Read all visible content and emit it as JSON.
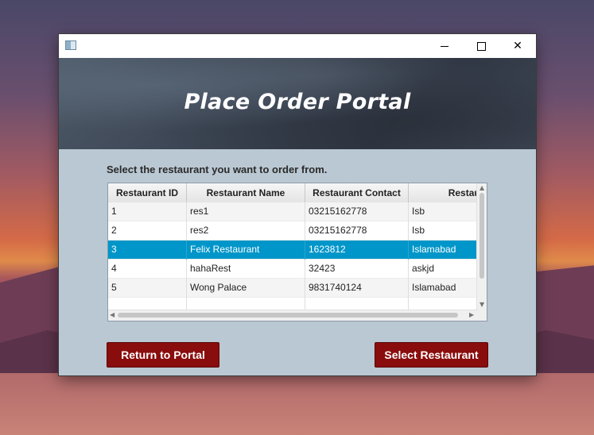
{
  "window": {
    "controls": {
      "minimize": "minimize",
      "maximize": "maximize",
      "close": "✕"
    }
  },
  "banner": {
    "title": "Place Order Portal"
  },
  "prompt": "Select the restaurant you want to order from.",
  "table": {
    "columns": [
      "Restaurant ID",
      "Restaurant Name",
      "Restaurant Contact",
      "Restaurant Ad"
    ],
    "rows": [
      [
        "1",
        "res1",
        "03215162778",
        "Isb"
      ],
      [
        "2",
        "res2",
        "03215162778",
        "Isb"
      ],
      [
        "3",
        "Felix Restaurant",
        "1623812",
        "Islamabad"
      ],
      [
        "4",
        "hahaRest",
        "32423",
        "askjd"
      ],
      [
        "5",
        "Wong Palace",
        "9831740124",
        "Islamabad"
      ]
    ],
    "selected_row": 3
  },
  "buttons": {
    "return": "Return to Portal",
    "select": "Select Restaurant"
  },
  "colors": {
    "selection": "#0096c9",
    "button": "#8a0d0d",
    "panel": "#bac8d3"
  }
}
